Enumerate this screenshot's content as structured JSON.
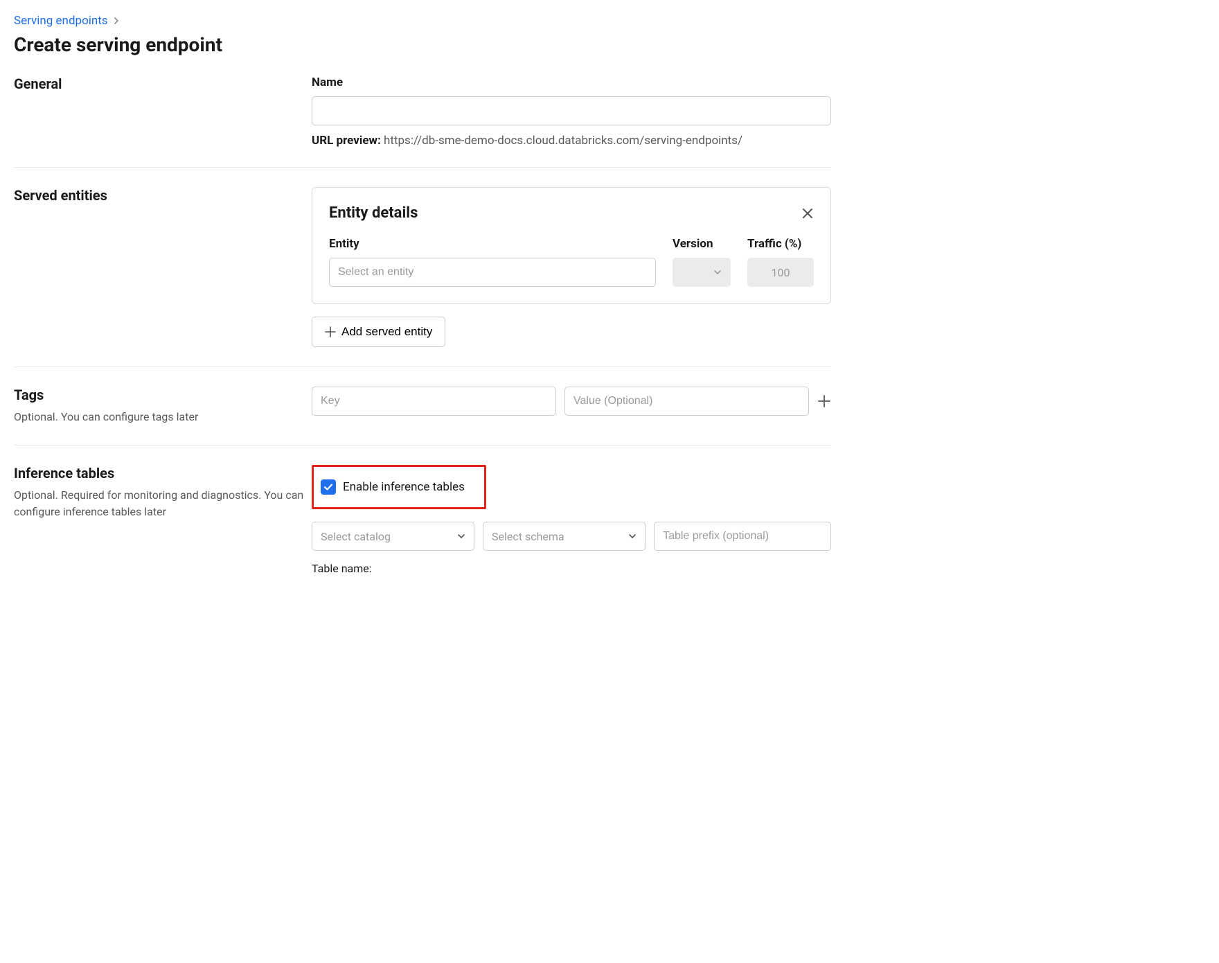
{
  "breadcrumb": {
    "root": "Serving endpoints"
  },
  "page_title": "Create serving endpoint",
  "general": {
    "heading": "General",
    "name_label": "Name",
    "name_value": "",
    "url_preview_label": "URL preview:",
    "url_preview_value": "https://db-sme-demo-docs.cloud.databricks.com/serving-endpoints/"
  },
  "served": {
    "heading": "Served entities",
    "card_title": "Entity details",
    "entity_label": "Entity",
    "version_label": "Version",
    "traffic_label": "Traffic (%)",
    "entity_placeholder": "Select an entity",
    "traffic_value": "100",
    "add_button": "Add served entity"
  },
  "tags": {
    "heading": "Tags",
    "subheading": "Optional. You can configure tags later",
    "key_placeholder": "Key",
    "value_placeholder": "Value (Optional)"
  },
  "inference": {
    "heading": "Inference tables",
    "subheading": "Optional. Required for monitoring and diagnostics. You can configure inference tables later",
    "checkbox_label": "Enable inference tables",
    "checkbox_checked": true,
    "catalog_placeholder": "Select catalog",
    "schema_placeholder": "Select schema",
    "prefix_placeholder": "Table prefix (optional)",
    "table_name_label": "Table name:"
  }
}
